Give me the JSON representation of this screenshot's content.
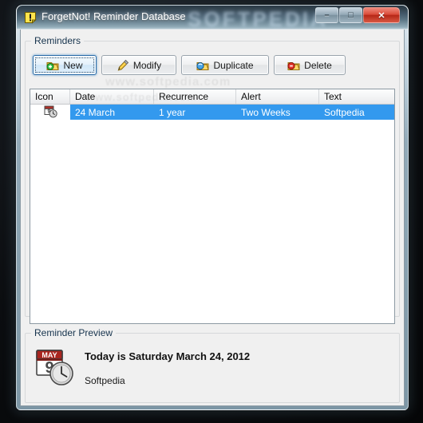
{
  "window": {
    "title": "ForgetNot! Reminder Database",
    "app_icon": "exclamation-note-icon",
    "watermark": "SOFTPEDIA",
    "watermark_small": "www.softpedia.com",
    "controls": {
      "minimize": "–",
      "maximize": "□",
      "close": "✕"
    }
  },
  "reminders_group": {
    "label": "Reminders",
    "buttons": [
      {
        "label": "New",
        "icon": "new-reminder-icon",
        "focused": true
      },
      {
        "label": "Modify",
        "icon": "pencil-icon",
        "focused": false
      },
      {
        "label": "Duplicate",
        "icon": "duplicate-icon",
        "focused": false
      },
      {
        "label": "Delete",
        "icon": "delete-icon",
        "focused": false
      }
    ]
  },
  "listview": {
    "columns": [
      "Icon",
      "Date",
      "Recurrence",
      "Alert",
      "Text"
    ],
    "rows": [
      {
        "icon": "calendar-clock-icon",
        "date": "24 March",
        "recurrence": "1 year",
        "alert": "Two Weeks",
        "text": "Softpedia",
        "selected": true
      }
    ]
  },
  "preview_group": {
    "label": "Reminder Preview",
    "icon": "calendar-clock-large-icon",
    "calendar_month": "MAY",
    "calendar_day": "9",
    "title": "Today is Saturday March 24, 2012",
    "text": "Softpedia"
  },
  "colors": {
    "selection_blue": "#3399ee",
    "client_bg": "#f0f0f0",
    "close_red": "#d94a38",
    "title_text": "#ffffff"
  }
}
